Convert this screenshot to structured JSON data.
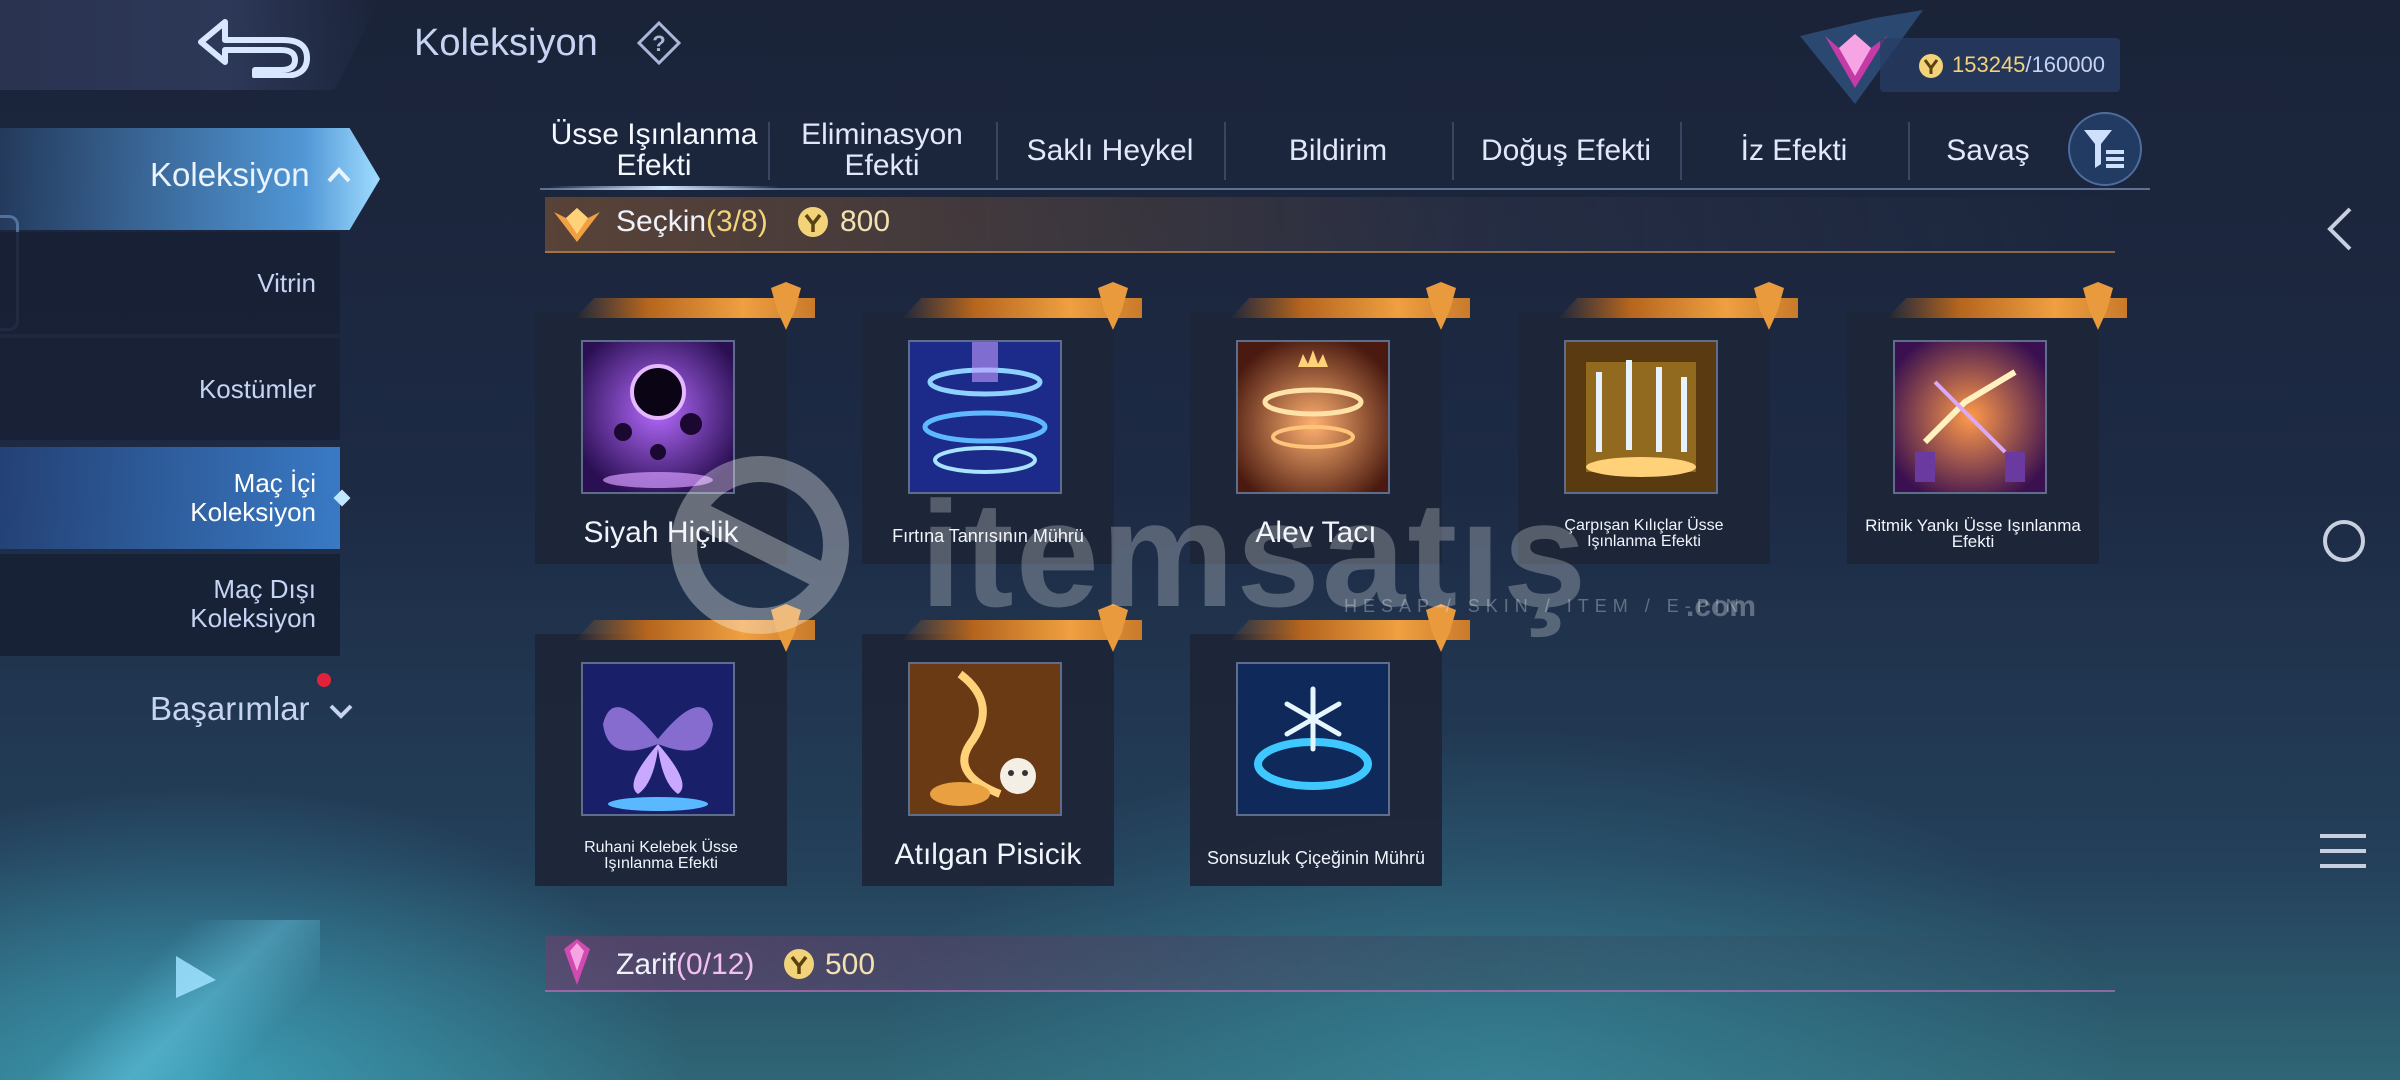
{
  "header": {
    "title": "Koleksiyon",
    "currency": {
      "value": "153245",
      "max": "/160000"
    }
  },
  "sidebar": {
    "main": "Koleksiyon",
    "items": [
      {
        "label": "Vitrin"
      },
      {
        "label": "Kostümler"
      },
      {
        "label": "Maç İçi\nKoleksiyon",
        "active": true
      },
      {
        "label": "Maç Dışı\nKoleksiyon"
      }
    ],
    "achievements": "Başarımlar"
  },
  "tabs": [
    {
      "label": "Üsse Işınlanma\nEfekti",
      "active": true
    },
    {
      "label": "Eliminasyon\nEfekti"
    },
    {
      "label": "Saklı Heykel"
    },
    {
      "label": "Bildirim"
    },
    {
      "label": "Doğuş Efekti"
    },
    {
      "label": "İz Efekti"
    },
    {
      "label": "Savaş"
    }
  ],
  "sections": [
    {
      "name": "Seçkin",
      "count": "(3/8)",
      "cost": "800"
    },
    {
      "name": "Zarif",
      "count": "(0/12)",
      "cost": "500"
    }
  ],
  "items": [
    {
      "name": "Siyah Hiçlik"
    },
    {
      "name": "Fırtına Tanrısının Mührü"
    },
    {
      "name": "Alev Tacı"
    },
    {
      "name": "Çarpışan Kılıçlar Üsse\nIşınlanma Efekti"
    },
    {
      "name": "Ritmik Yankı Üsse Işınlanma\nEfekti"
    },
    {
      "name": "Ruhani Kelebek Üsse\nIşınlanma Efekti"
    },
    {
      "name": "Atılgan Pisicik"
    },
    {
      "name": "Sonsuzluk Çiçeğinin Mührü"
    }
  ],
  "watermark": {
    "brand": "itemsatış",
    "tagline": "HESAP / SKIN / ITEM / E-PIN",
    "suffix": ".com"
  },
  "colors": {
    "gold": "#f3d37a",
    "accent": "#9fdcff",
    "ribbon": "#f0a040"
  }
}
